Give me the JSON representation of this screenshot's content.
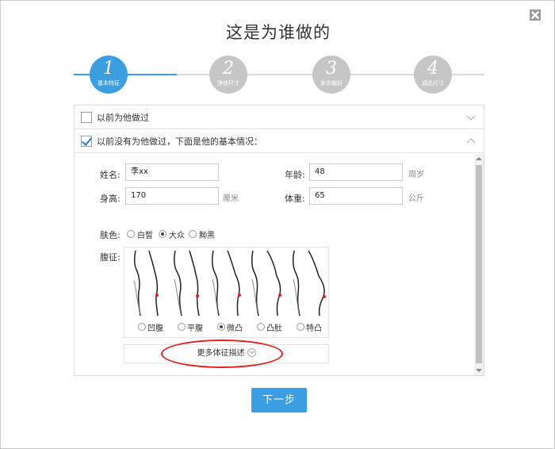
{
  "dialog": {
    "title": "这是为谁做的",
    "close_icon": "close-icon"
  },
  "steps": [
    {
      "num": "1",
      "label": "基本特征",
      "active": true
    },
    {
      "num": "2",
      "label": "净体尺寸",
      "active": false
    },
    {
      "num": "3",
      "label": "穿衣偏好",
      "active": false
    },
    {
      "num": "4",
      "label": "成品尺寸",
      "active": false
    }
  ],
  "accordion": {
    "made_before": {
      "label": "以前为他做过",
      "checked": false
    },
    "not_made_before": {
      "label": "以前没有为他做过，下面是他的基本情况：",
      "checked": true
    }
  },
  "form": {
    "name": {
      "label": "姓名:",
      "value": "李xx"
    },
    "age": {
      "label": "年龄:",
      "value": "48",
      "unit": "周岁"
    },
    "height": {
      "label": "身高:",
      "value": "170",
      "unit": "厘米"
    },
    "weight": {
      "label": "体重:",
      "value": "65",
      "unit": "公斤"
    },
    "skin": {
      "label": "肤色:",
      "options": [
        "白皙",
        "大众",
        "黝黑"
      ],
      "selected": "大众"
    },
    "belly": {
      "label": "腹征:",
      "options": [
        "凹腹",
        "平腹",
        "微凸",
        "凸肚",
        "特凸"
      ],
      "selected": "微凸"
    },
    "more_label": "更多体征描述"
  },
  "actions": {
    "next_label": "下一步"
  },
  "colors": {
    "accent": "#3a9ee0",
    "inactive_step": "#c6c6c6",
    "highlight": "#e02020"
  }
}
